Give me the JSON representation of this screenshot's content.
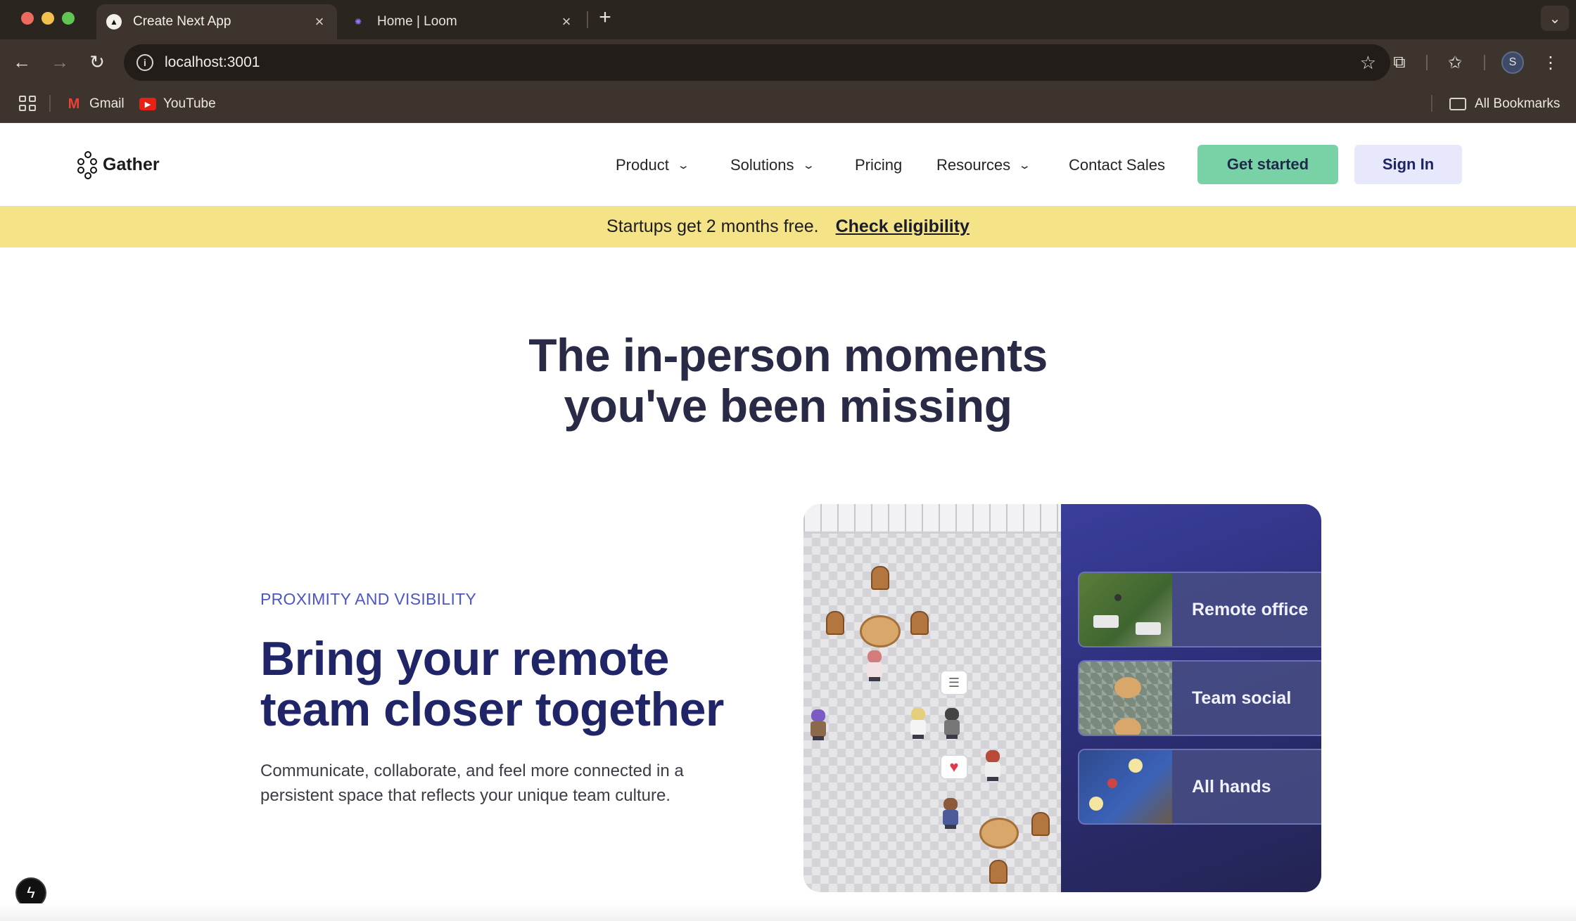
{
  "browser": {
    "tabs": [
      {
        "label": "Create Next App",
        "icon": "nextjs-icon",
        "active": true
      },
      {
        "label": "Home | Loom",
        "icon": "loom-icon",
        "active": false
      }
    ],
    "url": "localhost:3001",
    "profile_initial": "S",
    "bookmarks": [
      {
        "label": "Gmail",
        "icon": "gmail-icon"
      },
      {
        "label": "YouTube",
        "icon": "youtube-icon"
      }
    ],
    "all_bookmarks": "All Bookmarks"
  },
  "site": {
    "logo": "Gather",
    "nav": {
      "product": "Product",
      "solutions": "Solutions",
      "pricing": "Pricing",
      "resources": "Resources",
      "contact": "Contact Sales"
    },
    "get_started": "Get started",
    "sign_in": "Sign In"
  },
  "promo": {
    "text": "Startups get 2 months free.",
    "link": "Check eligibility"
  },
  "hero": {
    "title_line1": "The in-person moments",
    "title_line2": "you've been missing"
  },
  "feature": {
    "eyebrow": "PROXIMITY AND VISIBILITY",
    "title_line1": "Bring your remote",
    "title_line2": "team closer together",
    "desc_line1": "Communicate, collaborate, and feel more connected in a",
    "desc_line2": "persistent space that reflects your unique team culture.",
    "rooms": [
      {
        "label": "Remote office"
      },
      {
        "label": "Team social"
      },
      {
        "label": "All hands"
      }
    ]
  },
  "colors": {
    "accent_green": "#79d2a6",
    "sign_in_bg": "#e7e8fb",
    "promo_bg": "#f5e387",
    "heading_navy": "#202567",
    "eyebrow_purple": "#4d56c2"
  }
}
